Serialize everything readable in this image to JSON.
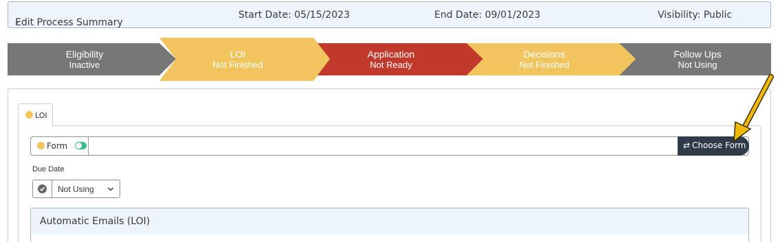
{
  "summary": {
    "toggle_label": "Edit Process Summary",
    "start_date": "Start Date: 05/15/2023",
    "end_date": "End Date: 09/01/2023",
    "visibility": "Visibility: Public"
  },
  "pipeline": {
    "stages": [
      {
        "name": "Eligibility",
        "status": "Inactive",
        "color": "#777777",
        "text_color": "#ffffff"
      },
      {
        "name": "LOI",
        "status": "Not Finished",
        "color": "#f2c45e",
        "text_color": "#ffffff"
      },
      {
        "name": "Application",
        "status": "Not Ready",
        "color": "#c0392b",
        "text_color": "#ffffff"
      },
      {
        "name": "Decisions",
        "status": "Not Finished",
        "color": "#f2c45e",
        "text_color": "#ffffff"
      },
      {
        "name": "Follow Ups",
        "status": "Not Using",
        "color": "#777777",
        "text_color": "#ffffff"
      }
    ]
  },
  "tab": {
    "label": "LOI"
  },
  "form": {
    "label": "Form",
    "toggle_on": true,
    "choose_label": "Choose Form",
    "choose_icon": "swap-arrows-icon"
  },
  "due_date": {
    "label": "Due Date",
    "selected": "Not Using"
  },
  "emails": {
    "title": "Automatic Emails (LOI)"
  },
  "colors": {
    "accent_yellow": "#f2c45e",
    "danger_red": "#c0392b",
    "inactive_gray": "#777777",
    "toggle_green": "#3cbf8a",
    "dark_button": "#2f3b48",
    "annotation_arrow": "#f0b90b"
  }
}
